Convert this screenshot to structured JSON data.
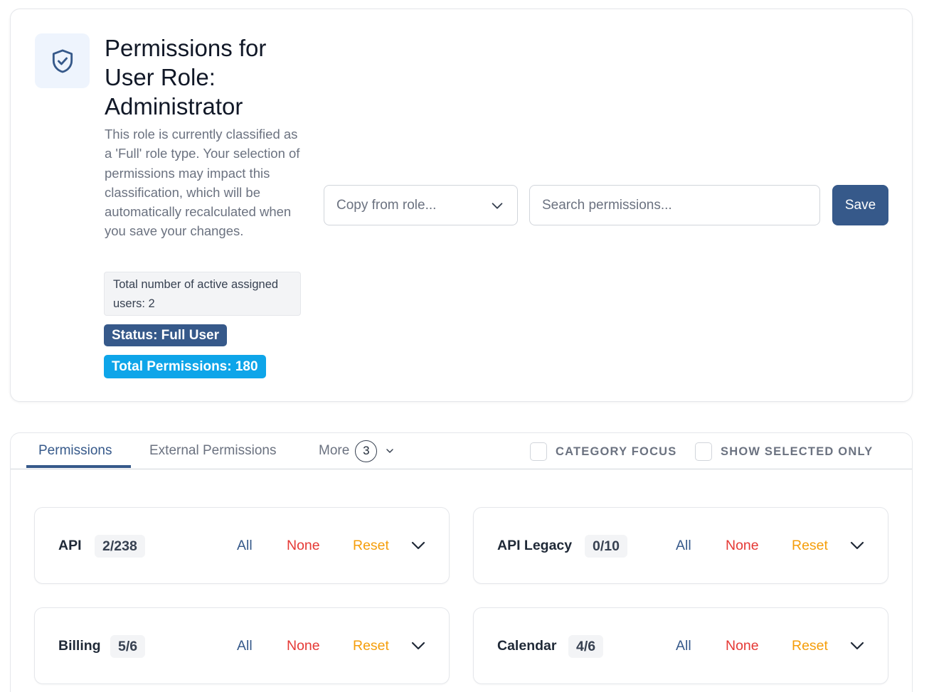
{
  "header": {
    "title": "Permissions for User Role: Administrator",
    "description": "This role is currently classified as a 'Full' role type. Your selection of permissions may impact this classification, which will be automatically recalculated when you save your changes.",
    "active_users": "Total number of active assigned users: 2",
    "status_badge": "Status: Full User",
    "total_badge": "Total Permissions: 180",
    "copy_placeholder": "Copy from role...",
    "search_placeholder": "Search permissions...",
    "save_label": "Save"
  },
  "tabs": {
    "permissions": "Permissions",
    "external": "External Permissions",
    "more": "More",
    "more_count": "3"
  },
  "filters": {
    "category_focus": "CATEGORY FOCUS",
    "show_selected": "SHOW SELECTED ONLY"
  },
  "actions": {
    "all": "All",
    "none": "None",
    "reset": "Reset"
  },
  "categories": [
    {
      "name": "API",
      "count": "2/238"
    },
    {
      "name": "API Legacy",
      "count": "0/10"
    },
    {
      "name": "Billing",
      "count": "5/6"
    },
    {
      "name": "Calendar",
      "count": "4/6"
    }
  ],
  "colors": {
    "primary": "#36598a",
    "accent": "#0ea5e9",
    "danger": "#e53935",
    "warning": "#f59e0b"
  }
}
